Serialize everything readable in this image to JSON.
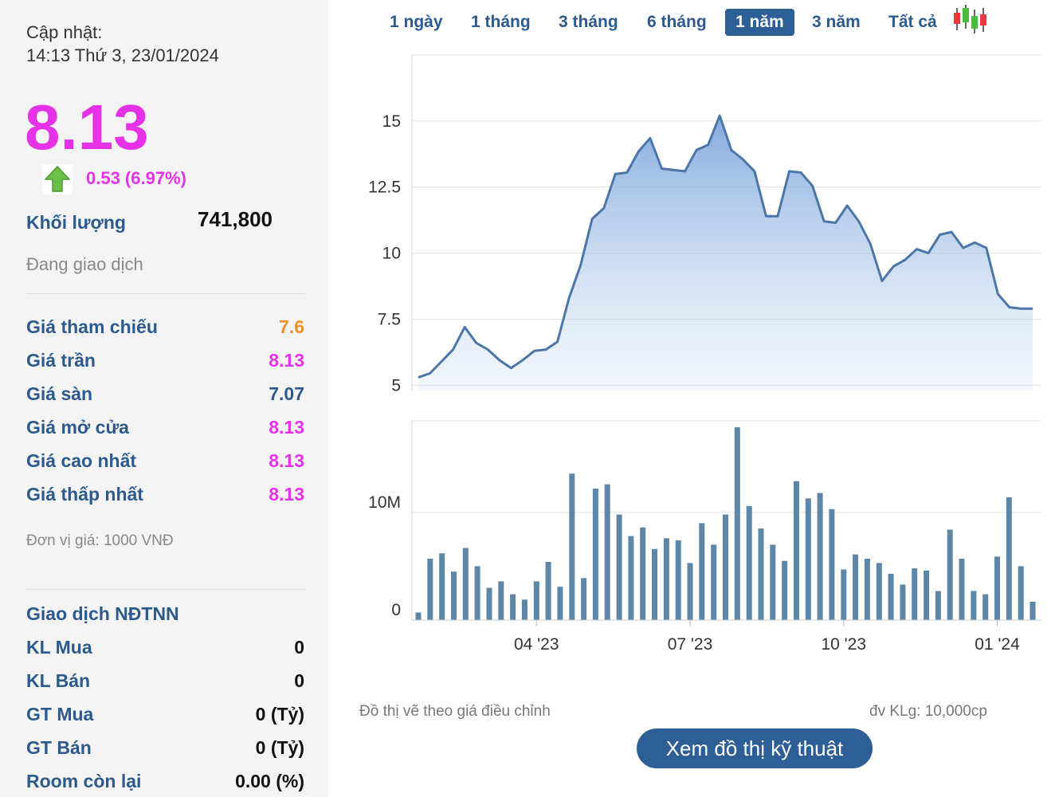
{
  "info": {
    "update_label": "Cập nhật:",
    "update_time": "14:13 Thứ 3, 23/01/2024",
    "price": "8.13",
    "change": "0.53 (6.97%)",
    "volume_label": "Khối lượng",
    "volume": "741,800",
    "status": "Đang giao dịch",
    "ref_label": "Giá tham chiếu",
    "ref": "7.6",
    "ceil_label": "Giá trần",
    "ceil": "8.13",
    "floor_label": "Giá sàn",
    "floor": "7.07",
    "open_label": "Giá mở cửa",
    "open": "8.13",
    "high_label": "Giá cao nhất",
    "high": "8.13",
    "low_label": "Giá thấp nhất",
    "low": "8.13",
    "unit_note": "Đơn vị giá: 1000 VNĐ",
    "foreign_title": "Giao dịch NĐTNN",
    "kl_mua_label": "KL Mua",
    "kl_mua": "0",
    "kl_ban_label": "KL Bán",
    "kl_ban": "0",
    "gt_mua_label": "GT Mua",
    "gt_mua": "0 (Tỷ)",
    "gt_ban_label": "GT Bán",
    "gt_ban": "0 (Tỷ)",
    "room_label": "Room còn lại",
    "room": "0.00 (%)"
  },
  "colors": {
    "price_up": "#e632e6",
    "reference": "#f0902c",
    "floor": "#2c5a8c",
    "label": "#2c5a8c",
    "line": "#4a77a8",
    "bar": "#5e86a6",
    "active_tab": "#2e5e96"
  },
  "tabs": [
    "1 ngày",
    "1 tháng",
    "3 tháng",
    "6 tháng",
    "1 năm",
    "3 năm",
    "Tất cả"
  ],
  "active_tab": "1 năm",
  "icons": {
    "candlestick": "candlestick-icon",
    "arrow": "green-up-arrow-icon"
  },
  "notes": {
    "adjusted": "Đồ thị vẽ theo giá điều chỉnh",
    "volume_unit": "đv KLg: 10,000cp",
    "button": "Xem đồ thị kỹ thuật"
  },
  "chart_data": [
    {
      "type": "area",
      "ylim": [
        4.8,
        17.5
      ],
      "yticks": [
        5,
        7.5,
        10,
        12.5,
        15
      ],
      "ytick_labels": [
        "5",
        "7.5",
        "10",
        "12.5",
        "15"
      ],
      "grid": true,
      "x": [
        0,
        1,
        2,
        3,
        4,
        5,
        6,
        7,
        8,
        9,
        10,
        11,
        12,
        13,
        14,
        15,
        16,
        17,
        18,
        19,
        20,
        21,
        22,
        23,
        24,
        25,
        26,
        27,
        28,
        29,
        30,
        31,
        32,
        33,
        34,
        35,
        36,
        37,
        38,
        39,
        40,
        41,
        42,
        43,
        44,
        45,
        46,
        47,
        48,
        49,
        50,
        51,
        52,
        53
      ],
      "values": [
        5.3,
        5.45,
        5.9,
        6.35,
        7.2,
        6.6,
        6.35,
        5.95,
        5.65,
        5.95,
        6.3,
        6.35,
        6.65,
        8.3,
        9.55,
        11.3,
        11.7,
        13.0,
        13.05,
        13.85,
        14.35,
        13.2,
        13.15,
        13.1,
        13.9,
        14.1,
        15.2,
        13.9,
        13.55,
        13.1,
        11.4,
        11.4,
        13.1,
        13.05,
        12.55,
        11.2,
        11.15,
        11.8,
        11.2,
        10.35,
        8.95,
        9.5,
        9.75,
        10.15,
        10.0,
        10.7,
        10.8,
        10.2,
        10.4,
        10.2,
        8.45,
        7.95,
        7.9,
        7.9
      ]
    },
    {
      "type": "bar",
      "ylim": [
        0,
        18.5
      ],
      "yticks": [
        0,
        10
      ],
      "ytick_labels": [
        "0",
        "10M"
      ],
      "grid": true,
      "values": [
        0.7,
        5.7,
        6.2,
        4.5,
        6.7,
        5.0,
        3.0,
        3.6,
        2.4,
        1.9,
        3.6,
        5.4,
        3.1,
        13.6,
        3.9,
        12.2,
        12.6,
        9.8,
        7.8,
        8.6,
        6.6,
        7.6,
        7.4,
        5.3,
        9.0,
        7.0,
        9.8,
        17.9,
        10.6,
        8.5,
        7.0,
        5.5,
        12.9,
        11.3,
        11.8,
        10.3,
        4.7,
        6.1,
        5.7,
        5.3,
        4.3,
        3.3,
        4.8,
        4.6,
        2.7,
        8.4,
        5.7,
        2.7,
        2.4,
        5.9,
        11.4,
        5.0,
        1.7
      ],
      "x_tick_labels": [
        "04 '23",
        "07 '23",
        "10 '23",
        "01 '24"
      ],
      "x_tick_positions": [
        10,
        23,
        36,
        49
      ]
    }
  ]
}
